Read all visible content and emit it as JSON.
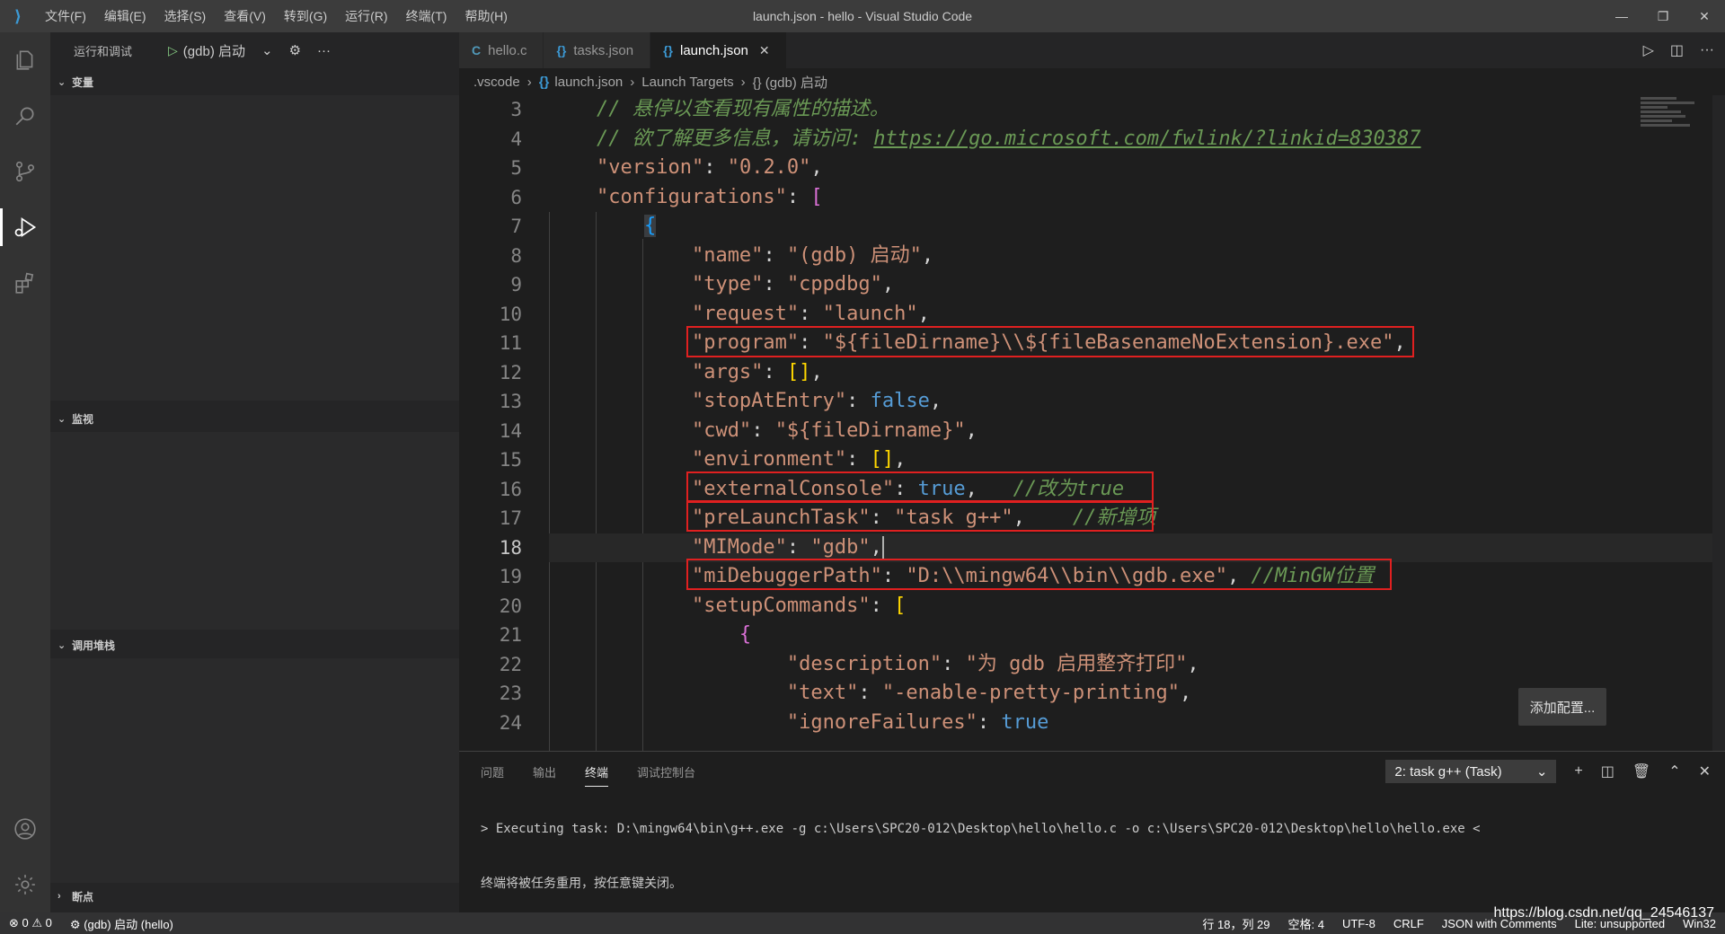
{
  "titlebar": {
    "menus": [
      "文件(F)",
      "编辑(E)",
      "选择(S)",
      "查看(V)",
      "转到(G)",
      "运行(R)",
      "终端(T)",
      "帮助(H)"
    ],
    "title": "launch.json - hello - Visual Studio Code"
  },
  "sidebar": {
    "title": "运行和调试",
    "config_name": "(gdb) 启动",
    "sections": {
      "variables": "变量",
      "watch": "监视",
      "callstack": "调用堆栈",
      "breakpoints": "断点"
    }
  },
  "tabs": [
    {
      "label": "hello.c",
      "icon": "c-file-icon"
    },
    {
      "label": "tasks.json",
      "icon": "json-file-icon"
    },
    {
      "label": "launch.json",
      "icon": "json-file-icon",
      "active": true
    }
  ],
  "breadcrumb": {
    "folder": ".vscode",
    "file": "launch.json",
    "node": "Launch Targets",
    "leaf": "{} (gdb) 启动"
  },
  "editor": {
    "line_numbers": [
      "3",
      "4",
      "5",
      "6",
      "7",
      "8",
      "9",
      "10",
      "11",
      "12",
      "13",
      "14",
      "15",
      "16",
      "17",
      "18",
      "19",
      "20",
      "21",
      "22",
      "23",
      "24"
    ],
    "current_line": "18",
    "comment_hover": "// 悬停以查看现有属性的描述。",
    "comment_more": "// 欲了解更多信息，请访问: ",
    "comment_link": "https://go.microsoft.com/fwlink/?linkid=830387",
    "version_key": "\"version\"",
    "version_val": "\"0.2.0\"",
    "configurations_key": "\"configurations\"",
    "name_key": "\"name\"",
    "name_val": "\"(gdb) 启动\"",
    "type_key": "\"type\"",
    "type_val": "\"cppdbg\"",
    "request_key": "\"request\"",
    "request_val": "\"launch\"",
    "program_key": "\"program\"",
    "program_val": "\"${fileDirname}\\\\${fileBasenameNoExtension}.exe\"",
    "args_key": "\"args\"",
    "stop_key": "\"stopAtEntry\"",
    "stop_val": "false",
    "cwd_key": "\"cwd\"",
    "cwd_val": "\"${fileDirname}\"",
    "env_key": "\"environment\"",
    "external_key": "\"externalConsole\"",
    "external_val": "true",
    "external_cmt": "//改为true",
    "prelaunch_key": "\"preLaunchTask\"",
    "prelaunch_val": "\"task g++\"",
    "prelaunch_cmt": "//新增项",
    "mimode_key": "\"MIMode\"",
    "mimode_val": "\"gdb\"",
    "midebugger_key": "\"miDebuggerPath\"",
    "midebugger_val": "\"D:\\\\mingw64\\\\bin\\\\gdb.exe\"",
    "midebugger_cmt": "//MinGW位置",
    "setup_key": "\"setupCommands\"",
    "desc_key": "\"description\"",
    "desc_val": "\"为 gdb 启用整齐打印\"",
    "text_key": "\"text\"",
    "text_val": "\"-enable-pretty-printing\"",
    "ignore_key": "\"ignoreFailures\"",
    "ignore_val": "true"
  },
  "add_config_label": "添加配置...",
  "panel": {
    "tabs": [
      "问题",
      "输出",
      "终端",
      "调试控制台"
    ],
    "active_tab": "终端",
    "terminal_select": "2: task g++ (Task)",
    "line1": "> Executing task: D:\\mingw64\\bin\\g++.exe -g c:\\Users\\SPC20-012\\Desktop\\hello\\hello.c -o c:\\Users\\SPC20-012\\Desktop\\hello\\hello.exe <",
    "line2": "终端将被任务重用，按任意键关闭。"
  },
  "statusbar": {
    "errors": "0",
    "warnings": "0",
    "debug_target": "(gdb) 启动 (hello)",
    "position": "行 18，列 29",
    "spaces": "空格: 4",
    "encoding": "UTF-8",
    "eol": "CRLF",
    "language": "JSON with Comments",
    "extra": "Lite: unsupported",
    "os": "Win32"
  },
  "watermark": "https://blog.csdn.net/qq_24546137"
}
